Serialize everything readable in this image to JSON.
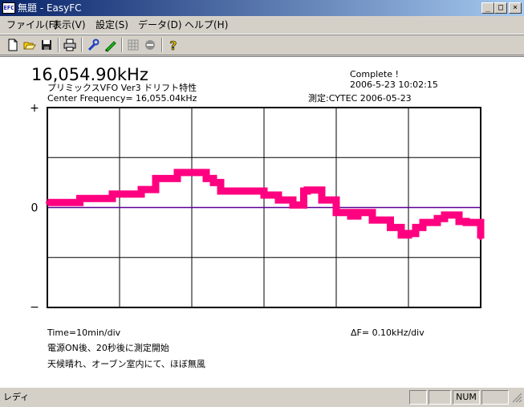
{
  "window": {
    "app_badge": "EFC",
    "title": "無題 - EasyFC",
    "minimize_glyph": "_",
    "maximize_glyph": "□",
    "close_glyph": "×"
  },
  "menu": [
    {
      "label": "ファイル(F)"
    },
    {
      "label": "表示(V)"
    },
    {
      "label": "設定(S)"
    },
    {
      "label": "データ(D)"
    },
    {
      "label": "ヘルプ(H)"
    }
  ],
  "toolbar": {
    "icons": [
      "new-icon",
      "open-icon",
      "save-icon",
      "print-icon",
      "wrench-icon",
      "pencil-icon",
      "grid-icon",
      "stop-icon",
      "help-icon"
    ]
  },
  "header": {
    "frequency": "16,054.90kHz",
    "device": "プリミックスVFO  Ver3  ドリフト特性",
    "center": "Center Frequency= 16,055.04kHz",
    "status": "Complete !",
    "datetime": "2006-5-23  10:02:15",
    "measured_by": "測定:CYTEC  2006-05-23"
  },
  "chart_data": {
    "type": "line",
    "title": "",
    "xlabel": "Time=10min/div",
    "ylabel": "ΔF=  0.10kHz/div",
    "y_axis_labels": {
      "top": "+",
      "mid": "0",
      "bottom": "−"
    },
    "x_divisions": 6,
    "y_divisions": 4,
    "xlim": [
      0,
      60
    ],
    "ylim": [
      -0.2,
      0.2
    ],
    "grid": true,
    "colors": {
      "trace": "#ff0080",
      "zero_line": "#5a0090",
      "grid": "#000000"
    },
    "series": [
      {
        "x": [
          0,
          4,
          4.5,
          8,
          9,
          10,
          13,
          15,
          17,
          18,
          19.5,
          22,
          23,
          24,
          27,
          30,
          32,
          34,
          35.5,
          36,
          38,
          40,
          42,
          43,
          45,
          47.5,
          49,
          50,
          51,
          52,
          54,
          55,
          57,
          58,
          59,
          60
        ],
        "y": [
          0.01,
          0.01,
          0.018,
          0.018,
          0.027,
          0.027,
          0.036,
          0.058,
          0.058,
          0.07,
          0.07,
          0.058,
          0.05,
          0.033,
          0.033,
          0.025,
          0.015,
          0.005,
          0.033,
          0.035,
          0.015,
          -0.01,
          -0.017,
          -0.01,
          -0.025,
          -0.04,
          -0.055,
          -0.052,
          -0.04,
          -0.03,
          -0.022,
          -0.015,
          -0.028,
          -0.03,
          -0.03,
          -0.062
        ]
      }
    ]
  },
  "footer": {
    "time_div": "Time=10min/div",
    "delta_f": "ΔF=  0.10kHz/div",
    "note1": "電源ON後、20秒後に測定開始",
    "note2": "天候晴れ、オーブン室内にて、ほぼ無風"
  },
  "statusbar": {
    "text": "レディ",
    "num": "NUM"
  }
}
